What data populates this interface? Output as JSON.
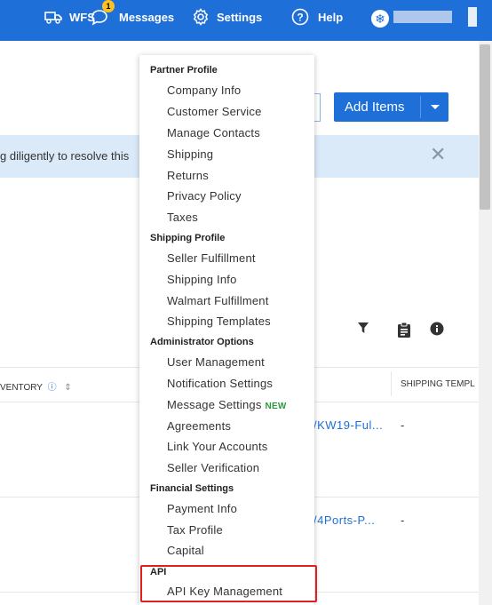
{
  "topbar": {
    "wfs_label": "WFS",
    "messages_label": "Messages",
    "messages_badge": "1",
    "settings_label": "Settings",
    "help_label": "Help",
    "avatar_glyph": "❄",
    "brand_color": "#1f6fd8"
  },
  "toolbar": {
    "add_items_label": "Add Items"
  },
  "banner": {
    "text": "g diligently to resolve this",
    "close_glyph": "✕"
  },
  "table": {
    "headers": {
      "inventory": "VENTORY",
      "shipping": "SHIPPING TEMPL"
    },
    "rows": [
      {
        "name": "/KW19-Ful...",
        "shipping": "-"
      },
      {
        "name": "/4Ports-P...",
        "shipping": "-"
      }
    ]
  },
  "menu": {
    "sections": [
      {
        "title": "Partner Profile",
        "items": [
          "Company Info",
          "Customer Service",
          "Manage Contacts",
          "Shipping",
          "Returns",
          "Privacy Policy",
          "Taxes"
        ]
      },
      {
        "title": "Shipping Profile",
        "items": [
          "Seller Fulfillment",
          "Shipping Info",
          "Walmart Fulfillment",
          "Shipping Templates"
        ]
      },
      {
        "title": "Administrator Options",
        "items": [
          "User Management",
          "Notification Settings",
          "Message Settings",
          "Agreements",
          "Link Your Accounts",
          "Seller Verification"
        ],
        "new_tag": "NEW"
      },
      {
        "title": "Financial Settings",
        "items": [
          "Payment Info",
          "Tax Profile",
          "Capital"
        ]
      },
      {
        "title": "API",
        "items": [
          "API Key Management"
        ]
      }
    ]
  }
}
